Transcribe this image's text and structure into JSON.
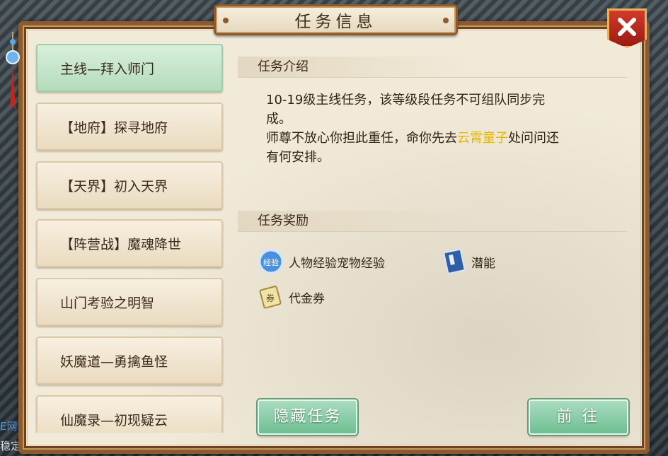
{
  "dialog": {
    "title": "任务信息"
  },
  "background": {
    "edge_text_1": "E网",
    "edge_text_2": "稳定"
  },
  "task_list": [
    {
      "label": "主线—拜入师门",
      "active": true
    },
    {
      "label": "【地府】探寻地府",
      "active": false
    },
    {
      "label": "【天界】初入天界",
      "active": false
    },
    {
      "label": "【阵营战】魔魂降世",
      "active": false
    },
    {
      "label": "山门考验之明智",
      "active": false
    },
    {
      "label": "妖魔道—勇擒鱼怪",
      "active": false
    },
    {
      "label": "仙魔录—初现疑云",
      "active": false
    }
  ],
  "intro": {
    "header": "任务介绍",
    "line1": "10-19级主线任务，该等级段任务不可组队同步完",
    "line2": "成。",
    "line3_pre": "师尊不放心你担此重任，命你先去",
    "line3_highlight": "云霄童子",
    "line3_post": "处问问还",
    "line4": "有何安排。"
  },
  "rewards": {
    "header": "任务奖励",
    "items": [
      {
        "label": "人物经验宠物经验",
        "icon": "exp-orb-icon",
        "icon_text": "经验"
      },
      {
        "label": "潜能",
        "icon": "book-icon"
      },
      {
        "label": "代金券",
        "icon": "voucher-icon",
        "icon_text": "券"
      }
    ]
  },
  "buttons": {
    "hide": "隐藏任务",
    "go": "前往"
  },
  "colors": {
    "accent_highlight": "#e5b800",
    "button_green": "#6fbf92",
    "frame_brown": "#8b5a2e",
    "close_red": "#c22a1e"
  }
}
